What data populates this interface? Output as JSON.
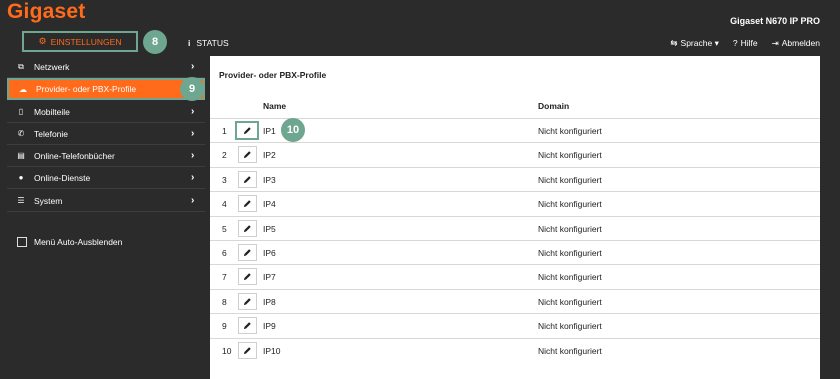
{
  "brand": {
    "logo": "Gigaset",
    "device": "Gigaset N670 IP PRO"
  },
  "tabs": {
    "settings": "EINSTELLUNGEN",
    "status": "STATUS"
  },
  "header_links": {
    "language": "Sprache",
    "help": "Hilfe",
    "logout": "Abmelden"
  },
  "badges": {
    "b8": "8",
    "b9": "9",
    "b10": "10"
  },
  "sidebar": {
    "items": [
      {
        "label": "Netzwerk",
        "icon": "network-icon"
      },
      {
        "label": "Provider- oder PBX-Profile",
        "icon": "cloud-icon"
      },
      {
        "label": "Mobilteile",
        "icon": "handset-icon"
      },
      {
        "label": "Telefonie",
        "icon": "phone-icon"
      },
      {
        "label": "Online-Telefonbücher",
        "icon": "book-icon"
      },
      {
        "label": "Online-Dienste",
        "icon": "globe-icon"
      },
      {
        "label": "System",
        "icon": "sliders-icon"
      }
    ],
    "auto_hide": "Menü Auto-Ausblenden"
  },
  "main": {
    "title": "Provider- oder PBX-Profile",
    "columns": {
      "name": "Name",
      "domain": "Domain"
    },
    "rows": [
      {
        "num": "1",
        "name": "IP1",
        "domain": "Nicht konfiguriert"
      },
      {
        "num": "2",
        "name": "IP2",
        "domain": "Nicht konfiguriert"
      },
      {
        "num": "3",
        "name": "IP3",
        "domain": "Nicht konfiguriert"
      },
      {
        "num": "4",
        "name": "IP4",
        "domain": "Nicht konfiguriert"
      },
      {
        "num": "5",
        "name": "IP5",
        "domain": "Nicht konfiguriert"
      },
      {
        "num": "6",
        "name": "IP6",
        "domain": "Nicht konfiguriert"
      },
      {
        "num": "7",
        "name": "IP7",
        "domain": "Nicht konfiguriert"
      },
      {
        "num": "8",
        "name": "IP8",
        "domain": "Nicht konfiguriert"
      },
      {
        "num": "9",
        "name": "IP9",
        "domain": "Nicht konfiguriert"
      },
      {
        "num": "10",
        "name": "IP10",
        "domain": "Nicht konfiguriert"
      }
    ]
  },
  "colors": {
    "accent": "#ff6b1a",
    "highlight": "#6fa68f",
    "background": "#2b2b2b"
  }
}
